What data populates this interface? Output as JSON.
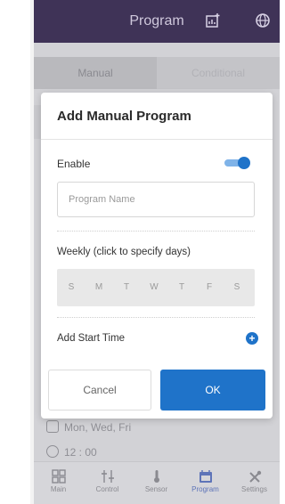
{
  "header": {
    "title": "Program",
    "icons": [
      "chart-add-icon",
      "globe-icon"
    ]
  },
  "segment": {
    "tabs": [
      "Manual",
      "Conditional"
    ],
    "active": 0
  },
  "background_list": {
    "days_text": "Mon, Wed, Fri",
    "time_text": "12 : 00"
  },
  "modal": {
    "title": "Add Manual Program",
    "enable_label": "Enable",
    "enable_on": true,
    "name_placeholder": "Program Name",
    "name_value": "",
    "weekly_label": "Weekly (click to specify days)",
    "days": [
      "S",
      "M",
      "T",
      "W",
      "T",
      "F",
      "S"
    ],
    "start_time_label": "Add Start Time",
    "cancel_label": "Cancel",
    "ok_label": "OK"
  },
  "nav": {
    "items": [
      {
        "label": "Main",
        "icon": "grid-icon"
      },
      {
        "label": "Control",
        "icon": "sliders-icon"
      },
      {
        "label": "Sensor",
        "icon": "thermometer-icon"
      },
      {
        "label": "Program",
        "icon": "calendar-icon"
      },
      {
        "label": "Settings",
        "icon": "tools-icon"
      }
    ],
    "active": 3
  },
  "colors": {
    "header": "#3f3357",
    "accent": "#1f73c9",
    "active_nav": "#5e74b8"
  }
}
